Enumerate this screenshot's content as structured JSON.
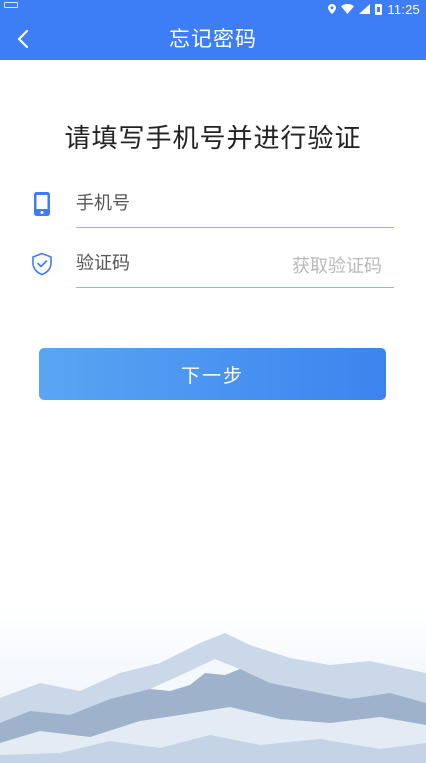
{
  "status_bar": {
    "time": "11:25"
  },
  "header": {
    "title": "忘记密码"
  },
  "main": {
    "prompt": "请填写手机号并进行验证",
    "phone_placeholder": "手机号",
    "code_placeholder": "验证码",
    "get_code_label": "获取验证码",
    "next_label": "下一步"
  },
  "colors": {
    "primary": "#3d7df5",
    "button_start": "#5aa5f3",
    "button_end": "#3d83ef",
    "divider": "#9bb4e6"
  }
}
